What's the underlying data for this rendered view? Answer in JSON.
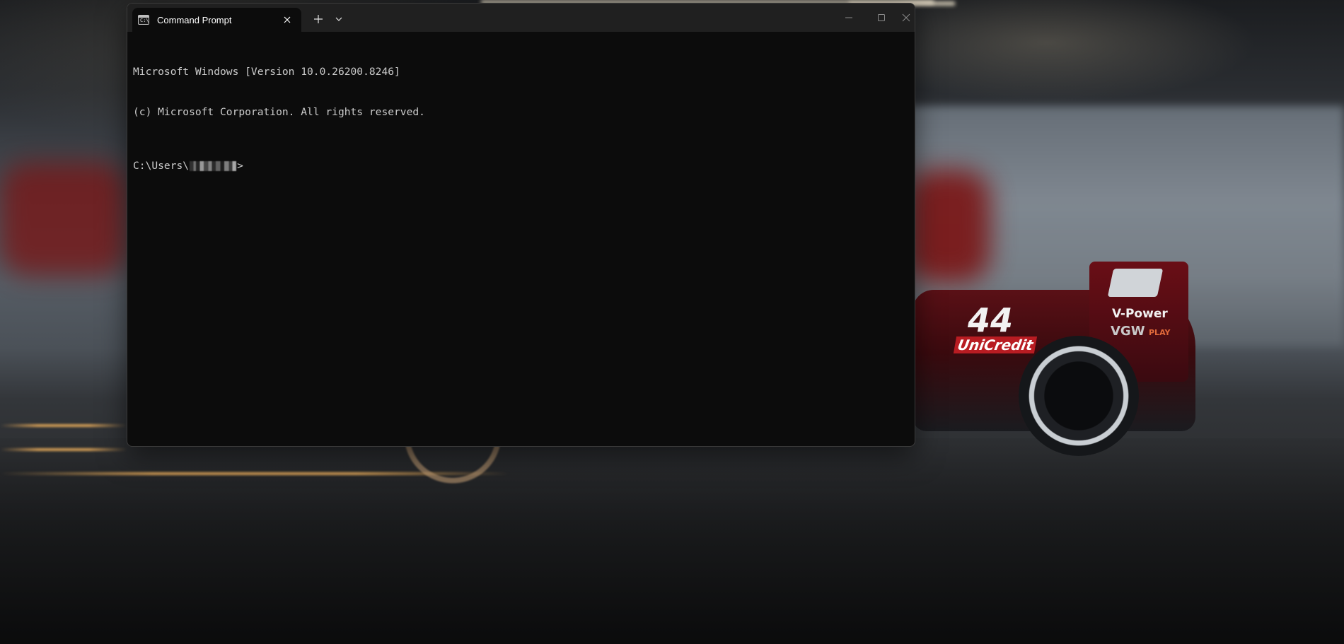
{
  "window": {
    "tab_title": "Command Prompt",
    "tab_icon": "command-prompt-icon",
    "tab_icon_glyph": "C:\\",
    "new_tab_icon": "plus-icon",
    "dropdown_icon": "chevron-down-icon",
    "minimize_icon": "minimize-icon",
    "maximize_icon": "maximize-icon",
    "close_icon": "close-icon"
  },
  "terminal": {
    "lines": [
      "Microsoft Windows [Version 10.0.26200.8246]",
      "(c) Microsoft Corporation. All rights reserved."
    ],
    "prompt_prefix": "C:\\Users\\",
    "prompt_suffix": ">"
  },
  "wallpaper": {
    "car_number": "44",
    "sponsor_1": "UniCredit",
    "sponsor_2": "V-Power",
    "sponsor_3": "VGW",
    "sponsor_3_sub": "PLAY"
  },
  "colors": {
    "terminal_bg": "#0c0c0c",
    "terminal_text": "#cccccc",
    "titlebar_bg": "#202020"
  }
}
